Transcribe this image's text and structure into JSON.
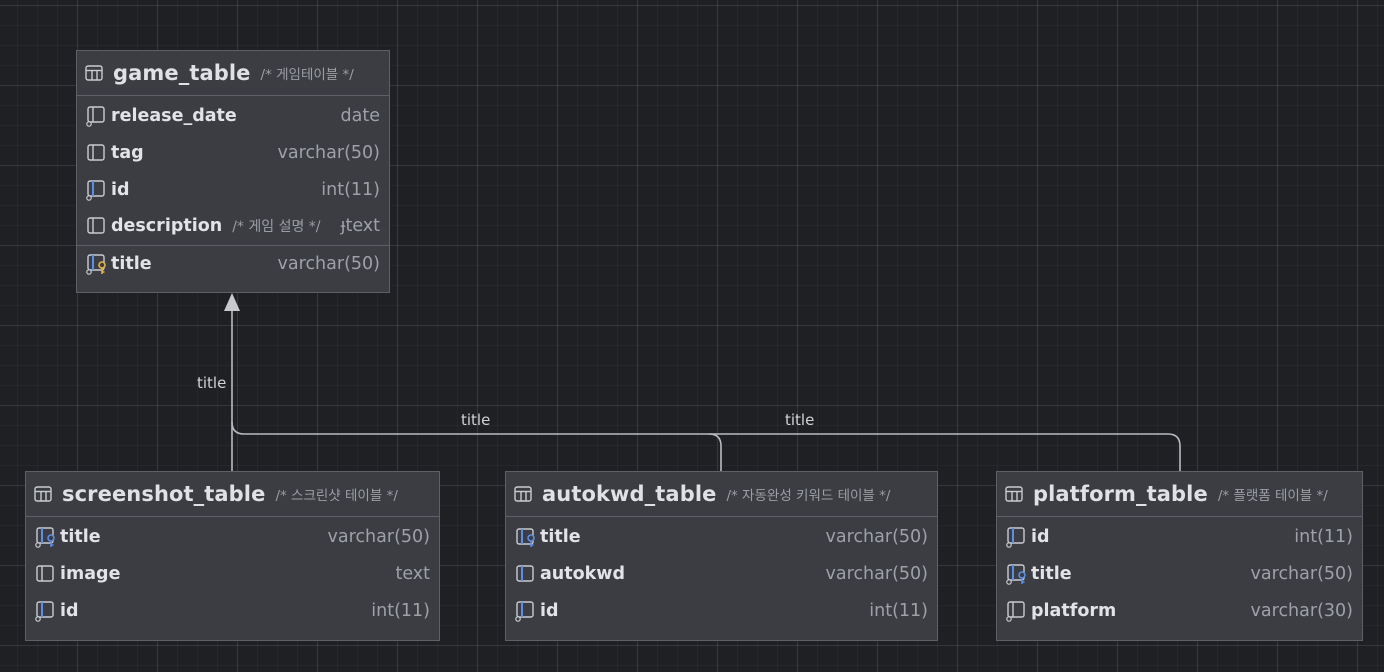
{
  "tables": {
    "game": {
      "name": "game_table",
      "comment": "/* 게임테이블 */",
      "columns": [
        {
          "name": "release_date",
          "type": "date",
          "icon": "column-icon"
        },
        {
          "name": "tag",
          "type": "varchar(50)",
          "icon": "column-icon"
        },
        {
          "name": "id",
          "type": "int(11)",
          "icon": "indexed-column-icon"
        },
        {
          "name": "description",
          "comment": "/* 게임 설명 */",
          "type": "ɟtext",
          "icon": "column-icon"
        },
        {
          "name": "title",
          "type": "varchar(50)",
          "icon": "primary-key-column-icon"
        }
      ]
    },
    "screenshot": {
      "name": "screenshot_table",
      "comment": "/* 스크린샷 테이블 */",
      "columns": [
        {
          "name": "title",
          "type": "varchar(50)",
          "icon": "foreign-key-column-icon"
        },
        {
          "name": "image",
          "type": "text",
          "icon": "column-icon"
        },
        {
          "name": "id",
          "type": "int(11)",
          "icon": "indexed-column-icon"
        }
      ]
    },
    "autokwd": {
      "name": "autokwd_table",
      "comment": "/* 자동완성 키워드 테이블 */",
      "columns": [
        {
          "name": "title",
          "type": "varchar(50)",
          "icon": "foreign-key-column-icon"
        },
        {
          "name": "autokwd",
          "type": "varchar(50)",
          "icon": "column-icon"
        },
        {
          "name": "id",
          "type": "int(11)",
          "icon": "indexed-column-icon"
        }
      ]
    },
    "platform": {
      "name": "platform_table",
      "comment": "/* 플랫폼 테이블 */",
      "columns": [
        {
          "name": "id",
          "type": "int(11)",
          "icon": "indexed-column-icon"
        },
        {
          "name": "title",
          "type": "varchar(50)",
          "icon": "foreign-key-column-icon"
        },
        {
          "name": "platform",
          "type": "varchar(30)",
          "icon": "column-icon"
        }
      ]
    }
  },
  "links": {
    "screenshot_label": "title",
    "autokwd_label": "title",
    "platform_label": "title"
  },
  "colors": {
    "background": "#1f2023",
    "table_fill": "#3b3d42",
    "key_blue": "#5b8ee6",
    "key_gold": "#e3b341",
    "link_line": "#b8bbc1"
  }
}
